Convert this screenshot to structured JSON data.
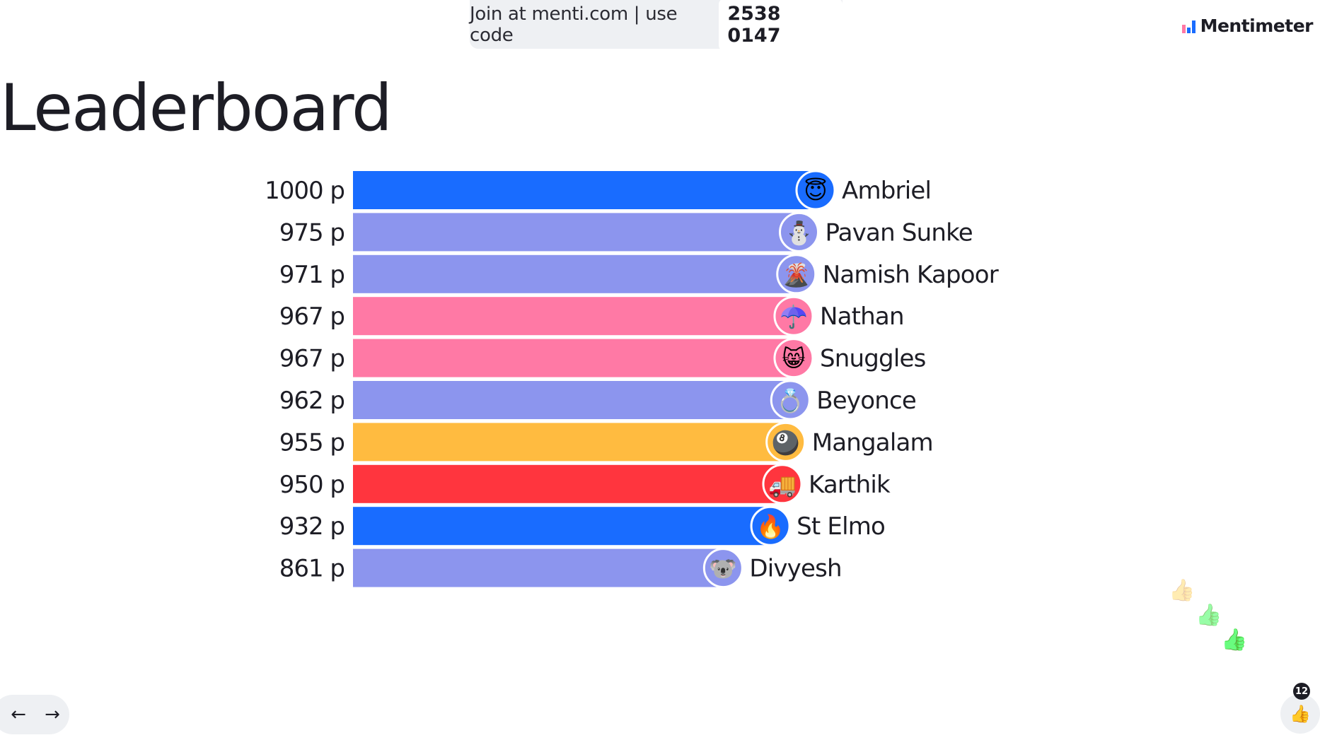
{
  "join": {
    "text": "Join at menti.com | use code",
    "code": "2538 0147"
  },
  "brand": {
    "name": "Mentimeter"
  },
  "title": "Leaderboard",
  "chart_data": {
    "type": "bar",
    "orientation": "horizontal",
    "title": "Leaderboard",
    "value_suffix": " p",
    "xlim": [
      0,
      1000
    ],
    "grid": false,
    "legend": "none",
    "categories": [
      "Ambriel",
      "Pavan Sunke",
      "Namish Kapoor",
      "Nathan",
      "Snuggles",
      "Beyonce",
      "Mangalam",
      "Karthik",
      "St Elmo",
      "Divyesh"
    ],
    "values": [
      1000,
      975,
      971,
      967,
      967,
      962,
      955,
      950,
      932,
      861
    ],
    "labels": [
      "1000 p",
      "975 p",
      "971 p",
      "967 p",
      "967 p",
      "962 p",
      "955 p",
      "950 p",
      "932 p",
      "861 p"
    ],
    "colors": [
      "#196cff",
      "#8c95ee",
      "#8c95ee",
      "#ff79a5",
      "#ff79a5",
      "#8c95ee",
      "#ffbb40",
      "#ff353e",
      "#196cff",
      "#8c95ee"
    ],
    "avatars": [
      "😇",
      "⛄",
      "🌋",
      "☂️",
      "😸",
      "💍",
      "🎱",
      "🚚",
      "🔥",
      "🐨"
    ],
    "avatar_names": [
      "angel-face-icon",
      "snowman-icon",
      "volcano-icon",
      "umbrella-icon",
      "grinning-cat-icon",
      "ring-icon",
      "eight-ball-icon",
      "truck-icon",
      "fire-icon",
      "koala-icon"
    ]
  },
  "nav": {
    "prev": "←",
    "next": "→"
  },
  "reactions": {
    "like_count": "12",
    "like_icon": "👍"
  }
}
